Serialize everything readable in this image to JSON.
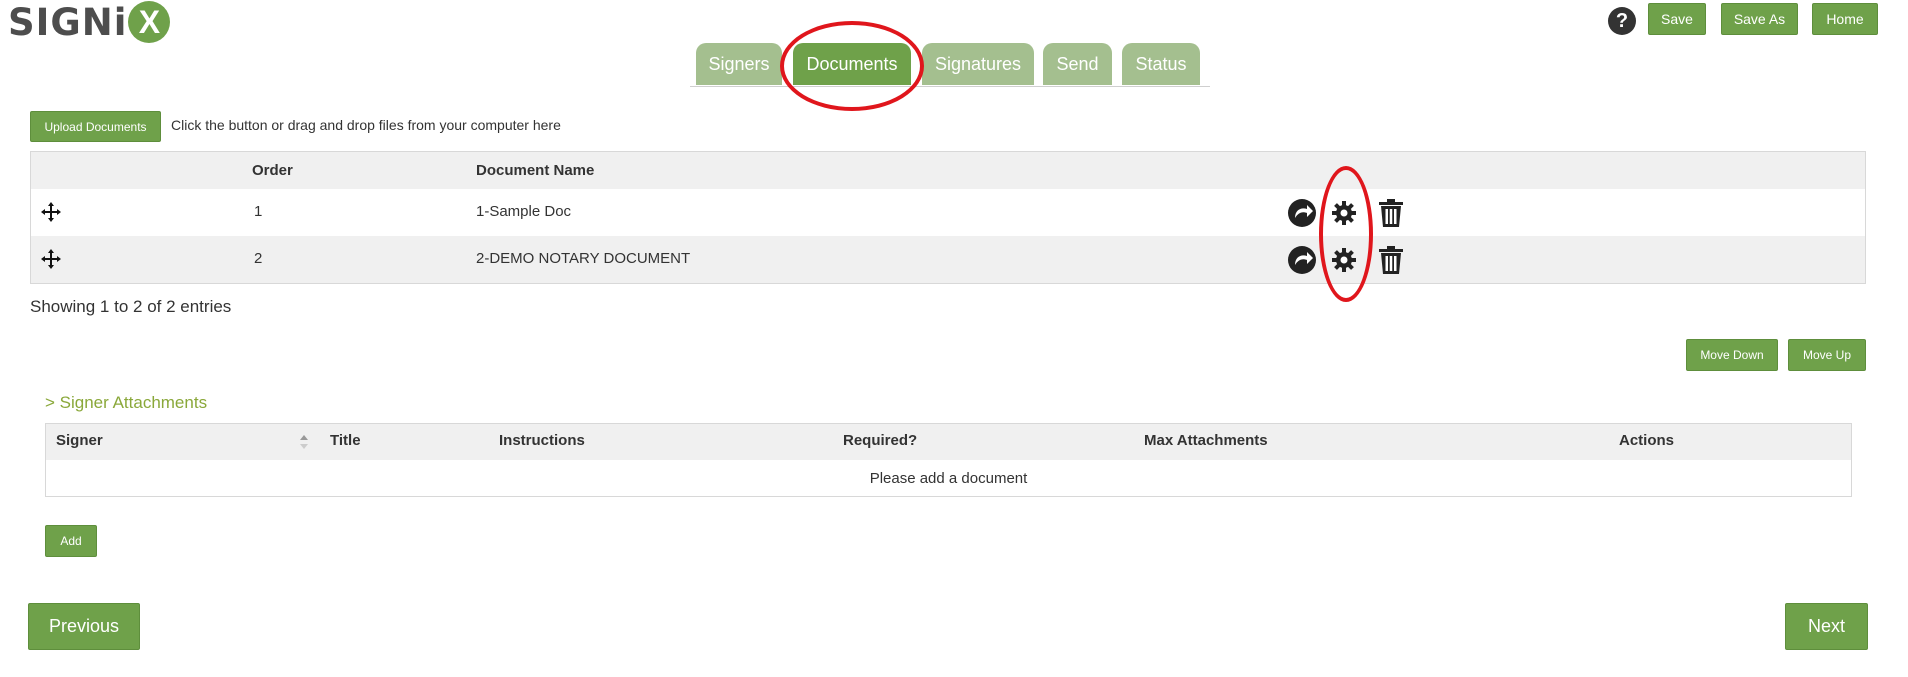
{
  "app": {
    "logo_text": "SIGNi",
    "logo_x": "X"
  },
  "header": {
    "help_glyph": "?",
    "save_label": "Save",
    "save_as_label": "Save As",
    "home_label": "Home"
  },
  "tabs": [
    {
      "label": "Signers",
      "active": false
    },
    {
      "label": "Documents",
      "active": true
    },
    {
      "label": "Signatures",
      "active": false
    },
    {
      "label": "Send",
      "active": false
    },
    {
      "label": "Status",
      "active": false
    }
  ],
  "upload": {
    "button_label": "Upload Documents",
    "hint": "Click the button or drag and drop files from your computer here"
  },
  "documents_table": {
    "headers": {
      "order": "Order",
      "name": "Document Name"
    },
    "rows": [
      {
        "order": "1",
        "name": "1-Sample Doc"
      },
      {
        "order": "2",
        "name": "2-DEMO NOTARY DOCUMENT"
      }
    ],
    "row_icons": [
      "move-icon",
      "replace-icon",
      "gear-icon",
      "trash-icon"
    ],
    "summary": "Showing 1 to 2 of 2 entries"
  },
  "order_controls": {
    "move_down_label": "Move Down",
    "move_up_label": "Move Up"
  },
  "attachments": {
    "section_title": "> Signer Attachments",
    "headers": {
      "signer": "Signer",
      "title": "Title",
      "instructions": "Instructions",
      "required": "Required?",
      "max": "Max Attachments",
      "actions": "Actions"
    },
    "empty_message": "Please add a document",
    "add_label": "Add"
  },
  "footer": {
    "previous_label": "Previous",
    "next_label": "Next"
  },
  "colors": {
    "brand_green": "#6fa14a",
    "tab_inactive": "#a4bf8f",
    "annotation_red": "#e0161c",
    "section_title": "#8aa83a"
  }
}
